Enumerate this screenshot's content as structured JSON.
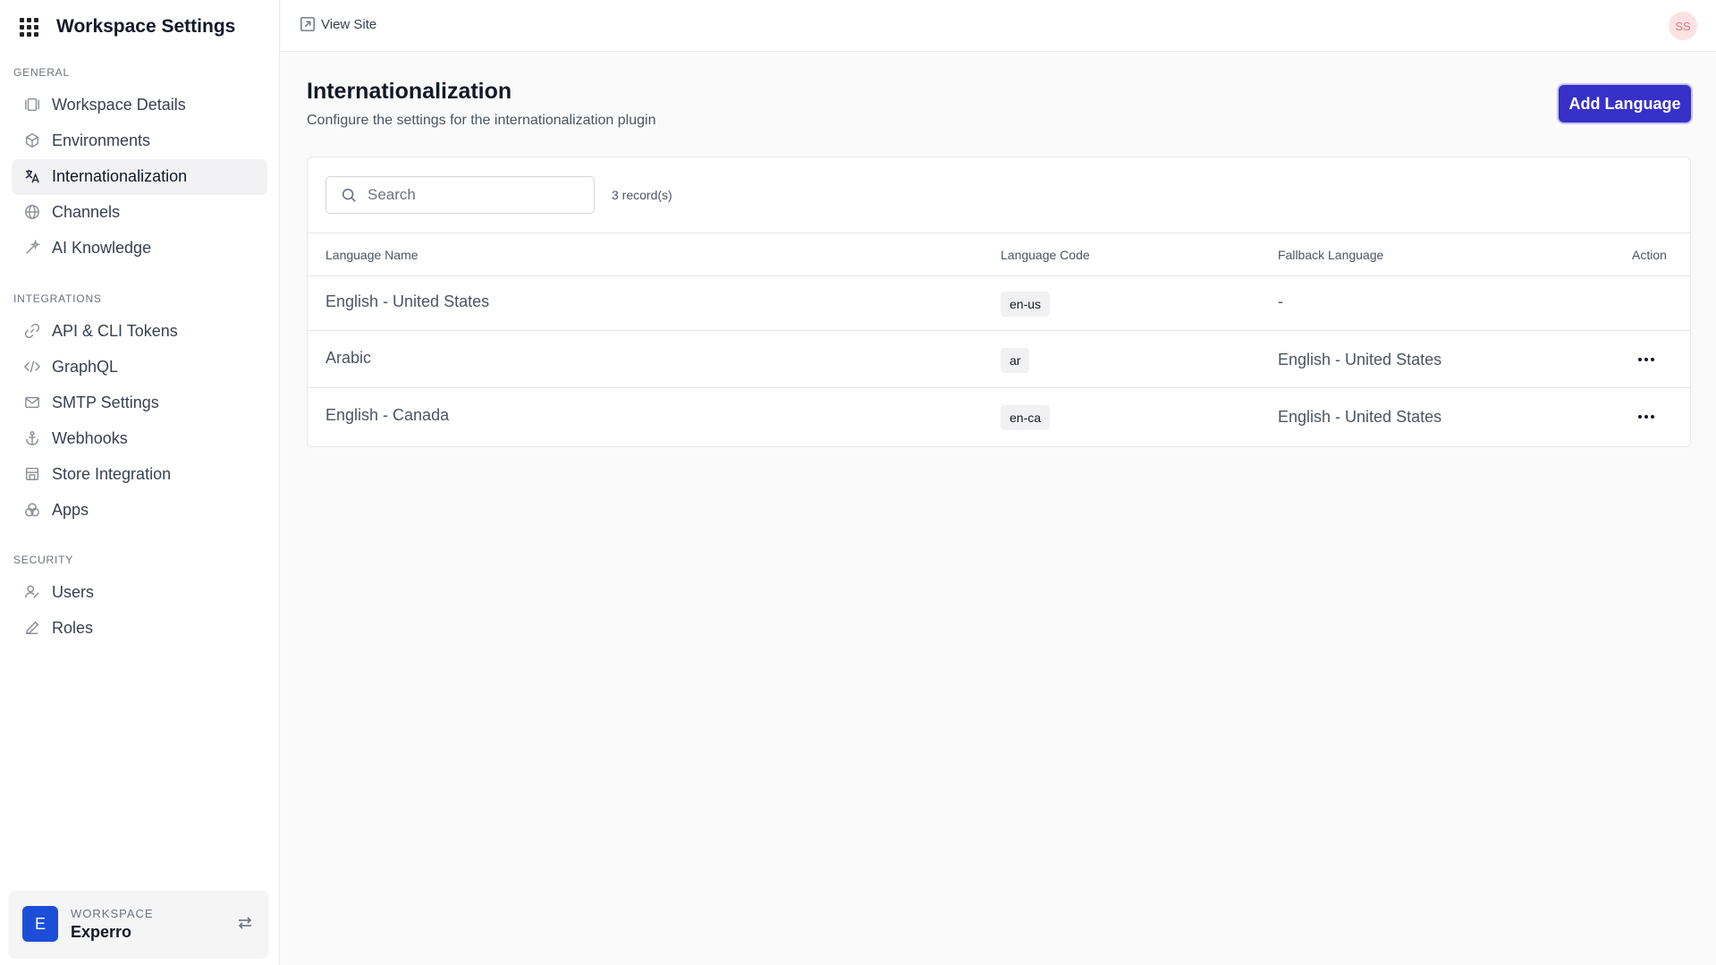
{
  "sidebar": {
    "title": "Workspace Settings",
    "sections": [
      {
        "title": "GENERAL",
        "items": [
          {
            "label": "Workspace Details",
            "icon": "columns-icon"
          },
          {
            "label": "Environments",
            "icon": "cube-icon"
          },
          {
            "label": "Internationalization",
            "icon": "translate-icon",
            "active": true
          },
          {
            "label": "Channels",
            "icon": "globe-icon"
          },
          {
            "label": "AI Knowledge",
            "icon": "sparkle-icon"
          }
        ]
      },
      {
        "title": "INTEGRATIONS",
        "items": [
          {
            "label": "API & CLI Tokens",
            "icon": "link-icon"
          },
          {
            "label": "GraphQL",
            "icon": "code-icon"
          },
          {
            "label": "SMTP Settings",
            "icon": "mail-icon"
          },
          {
            "label": "Webhooks",
            "icon": "anchor-icon"
          },
          {
            "label": "Store Integration",
            "icon": "store-icon"
          },
          {
            "label": "Apps",
            "icon": "apps-icon"
          }
        ]
      },
      {
        "title": "SECURITY",
        "items": [
          {
            "label": "Users",
            "icon": "users-icon"
          },
          {
            "label": "Roles",
            "icon": "pen-icon"
          }
        ]
      }
    ],
    "workspace": {
      "label": "WORKSPACE",
      "name": "Experro",
      "initial": "E"
    }
  },
  "topbar": {
    "view_site": "View Site",
    "avatar": "SS"
  },
  "page": {
    "title": "Internationalization",
    "subtitle": "Configure the settings for the internationalization plugin",
    "add_button": "Add Language"
  },
  "table": {
    "search_placeholder": "Search",
    "records": "3 record(s)",
    "columns": [
      "Language Name",
      "Language Code",
      "Fallback Language",
      "Action"
    ],
    "rows": [
      {
        "name": "English - United States",
        "code": "en-us",
        "fallback": "-"
      },
      {
        "name": "Arabic",
        "code": "ar",
        "fallback": "English - United States"
      },
      {
        "name": "English - Canada",
        "code": "en-ca",
        "fallback": "English - United States"
      }
    ]
  },
  "colors": {
    "primary": "#3730c9",
    "workspace_avatar": "#1d4ed8",
    "user_avatar_bg": "#fde2e4"
  }
}
